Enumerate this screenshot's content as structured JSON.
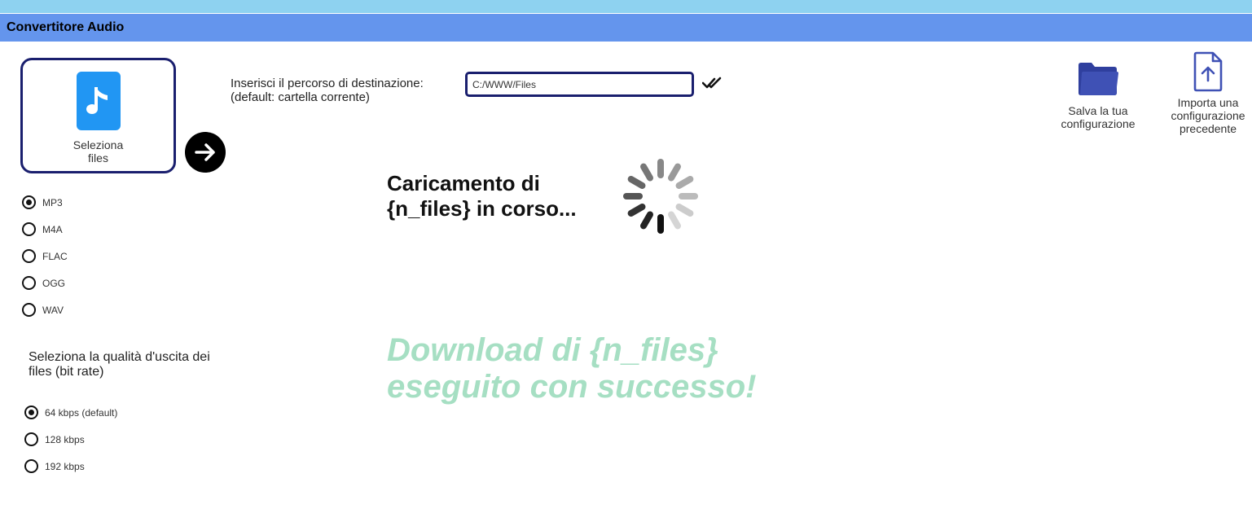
{
  "app": {
    "title": "Convertitore Audio"
  },
  "select_files": {
    "label": "Seleziona\nfiles",
    "icon": "music-note-icon"
  },
  "proceed": {
    "icon": "arrow-right-icon"
  },
  "formats": [
    {
      "label": "MP3",
      "checked": true
    },
    {
      "label": "M4A",
      "checked": false
    },
    {
      "label": "FLAC",
      "checked": false
    },
    {
      "label": "OGG",
      "checked": false
    },
    {
      "label": "WAV",
      "checked": false
    }
  ],
  "quality": {
    "title": "Seleziona la qualità d'uscita dei files (bit rate)",
    "options": [
      {
        "label": "64 kbps (default)",
        "checked": true
      },
      {
        "label": "128 kbps",
        "checked": false
      },
      {
        "label": "192 kbps",
        "checked": false
      }
    ]
  },
  "destination": {
    "label_line1": "Inserisci il percorso di destinazione:",
    "label_line2": "(default: cartella corrente)",
    "value": "C:/WWW/Files",
    "confirm_icon": "double-check-icon"
  },
  "loading": {
    "line1": "Caricamento di",
    "line2": "{n_files} in corso..."
  },
  "success": {
    "line1": "Download di {n_files}",
    "line2": "eseguito con successo!"
  },
  "save_config": {
    "line1": "Salva la tua",
    "line2": "configurazione",
    "icon": "folder-icon"
  },
  "import_config": {
    "line1": "Importa una",
    "line2": "configurazione",
    "line3": "precedente",
    "icon": "file-upload-icon"
  },
  "colors": {
    "accent": "#6495ed",
    "topstrip": "#8ed2f0",
    "border": "#1a1f6e",
    "success": "#a6dfc3",
    "folder": "#3f51b5"
  }
}
